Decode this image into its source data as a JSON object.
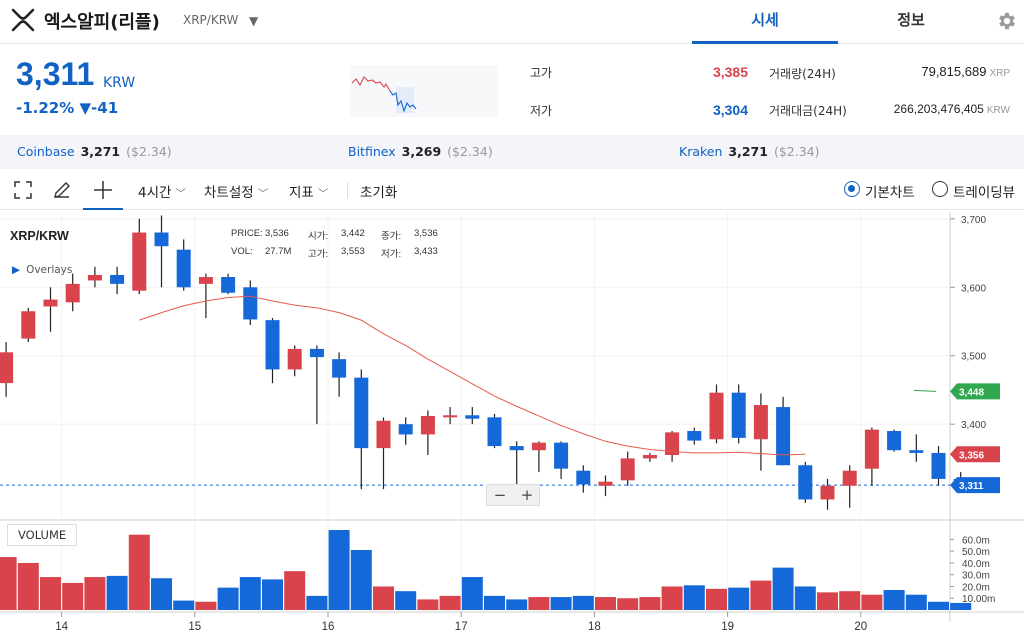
{
  "header": {
    "coin_name": "엑스알피(리플)",
    "pair": "XRP/KRW",
    "tabs": [
      {
        "label": "시세"
      },
      {
        "label": "정보"
      }
    ]
  },
  "ticker": {
    "price": "3,311",
    "unit": "KRW",
    "change_pct": "-1.22%",
    "change_arrow": "▼",
    "change_abs": "-41",
    "high_label": "고가",
    "high": "3,385",
    "low_label": "저가",
    "low": "3,304",
    "volume_label": "거래량(24H)",
    "volume": "79,815,689",
    "volume_unit": "XRP",
    "amount_label": "거래대금(24H)",
    "amount": "266,203,476,405",
    "amount_unit": "KRW"
  },
  "exchanges": [
    {
      "name": "Coinbase",
      "price": "3,271",
      "usd": "($2.34)"
    },
    {
      "name": "Bitfinex",
      "price": "3,269",
      "usd": "($2.34)"
    },
    {
      "name": "Kraken",
      "price": "3,271",
      "usd": "($2.34)"
    }
  ],
  "toolbar": {
    "interval": "4시간",
    "chart_settings": "차트설정",
    "indicators": "지표",
    "reset": "초기화",
    "basic_chart": "기본차트",
    "trading_view": "트레이딩뷰"
  },
  "legend": {
    "title": "XRP/KRW",
    "overlays": "Overlays",
    "price_label": "PRICE:",
    "price": "3,536",
    "open_label": "시가:",
    "open": "3,442",
    "close_label": "종가:",
    "close": "3,536",
    "vol_label": "VOL:",
    "vol": "27.7M",
    "high_label": "고가:",
    "high": "3,553",
    "low_label": "저가:",
    "low": "3,433"
  },
  "zoom": {
    "minus": "−",
    "plus": "+"
  },
  "volume_panel": {
    "label": "VOLUME"
  },
  "colors": {
    "up": "#d9434b",
    "down": "#1468d8",
    "accent": "#1261c4",
    "ma": "#e55a4e",
    "green": "#2fa84f"
  },
  "chart_data": {
    "type": "candlestick",
    "ylim": [
      3260,
      3710
    ],
    "y_ticks": [
      3700,
      3600,
      3500,
      3400
    ],
    "y_tick_labels": [
      "3,700",
      "3,600",
      "3,500",
      "3,400"
    ],
    "x_tick_labels": [
      "14",
      "15",
      "16",
      "17",
      "18",
      "19",
      "20"
    ],
    "x_tick_index": [
      2.5,
      8.5,
      14.5,
      20.5,
      26.5,
      32.5,
      38.5
    ],
    "price_markers": [
      {
        "label": "3,448",
        "value": 3448,
        "color": "#2fa84f"
      },
      {
        "label": "3,356",
        "value": 3356,
        "color": "#d9434b"
      },
      {
        "label": "3,311",
        "value": 3311,
        "color": "#1468d8"
      }
    ],
    "volume_ticks": [
      "60.0m",
      "50.0m",
      "40.0m",
      "30.0m",
      "20.0m",
      "10.00m"
    ],
    "volume_tick_values": [
      60,
      50,
      40,
      30,
      20,
      10
    ],
    "volume_max": 68,
    "candles": [
      {
        "o": 3460,
        "h": 3520,
        "l": 3440,
        "c": 3505
      },
      {
        "o": 3525,
        "h": 3570,
        "l": 3520,
        "c": 3565
      },
      {
        "o": 3572,
        "h": 3600,
        "l": 3535,
        "c": 3582
      },
      {
        "o": 3578,
        "h": 3620,
        "l": 3565,
        "c": 3605
      },
      {
        "o": 3610,
        "h": 3630,
        "l": 3600,
        "c": 3618
      },
      {
        "o": 3618,
        "h": 3630,
        "l": 3590,
        "c": 3605
      },
      {
        "o": 3595,
        "h": 3700,
        "l": 3590,
        "c": 3680
      },
      {
        "o": 3680,
        "h": 3705,
        "l": 3600,
        "c": 3660
      },
      {
        "o": 3655,
        "h": 3670,
        "l": 3595,
        "c": 3600
      },
      {
        "o": 3605,
        "h": 3620,
        "l": 3555,
        "c": 3615
      },
      {
        "o": 3615,
        "h": 3620,
        "l": 3590,
        "c": 3592
      },
      {
        "o": 3600,
        "h": 3610,
        "l": 3545,
        "c": 3553
      },
      {
        "o": 3552,
        "h": 3555,
        "l": 3460,
        "c": 3480
      },
      {
        "o": 3480,
        "h": 3515,
        "l": 3470,
        "c": 3510
      },
      {
        "o": 3510,
        "h": 3515,
        "l": 3400,
        "c": 3498
      },
      {
        "o": 3495,
        "h": 3505,
        "l": 3440,
        "c": 3468
      },
      {
        "o": 3468,
        "h": 3480,
        "l": 3305,
        "c": 3365
      },
      {
        "o": 3365,
        "h": 3410,
        "l": 3305,
        "c": 3405
      },
      {
        "o": 3400,
        "h": 3410,
        "l": 3370,
        "c": 3385
      },
      {
        "o": 3385,
        "h": 3420,
        "l": 3355,
        "c": 3412
      },
      {
        "o": 3410,
        "h": 3425,
        "l": 3400,
        "c": 3413
      },
      {
        "o": 3413,
        "h": 3425,
        "l": 3400,
        "c": 3408
      },
      {
        "o": 3410,
        "h": 3415,
        "l": 3365,
        "c": 3368
      },
      {
        "o": 3368,
        "h": 3375,
        "l": 3295,
        "c": 3362
      },
      {
        "o": 3362,
        "h": 3375,
        "l": 3330,
        "c": 3373
      },
      {
        "o": 3373,
        "h": 3375,
        "l": 3320,
        "c": 3335
      },
      {
        "o": 3332,
        "h": 3340,
        "l": 3300,
        "c": 3312
      },
      {
        "o": 3310,
        "h": 3325,
        "l": 3295,
        "c": 3316
      },
      {
        "o": 3318,
        "h": 3360,
        "l": 3310,
        "c": 3350
      },
      {
        "o": 3350,
        "h": 3358,
        "l": 3345,
        "c": 3355
      },
      {
        "o": 3355,
        "h": 3390,
        "l": 3345,
        "c": 3388
      },
      {
        "o": 3390,
        "h": 3395,
        "l": 3370,
        "c": 3376
      },
      {
        "o": 3378,
        "h": 3458,
        "l": 3372,
        "c": 3446
      },
      {
        "o": 3446,
        "h": 3458,
        "l": 3372,
        "c": 3380
      },
      {
        "o": 3378,
        "h": 3445,
        "l": 3332,
        "c": 3428
      },
      {
        "o": 3425,
        "h": 3440,
        "l": 3340,
        "c": 3340
      },
      {
        "o": 3340,
        "h": 3345,
        "l": 3285,
        "c": 3290
      },
      {
        "o": 3290,
        "h": 3320,
        "l": 3275,
        "c": 3310
      },
      {
        "o": 3310,
        "h": 3340,
        "l": 3278,
        "c": 3332
      },
      {
        "o": 3335,
        "h": 3395,
        "l": 3310,
        "c": 3392
      },
      {
        "o": 3390,
        "h": 3392,
        "l": 3360,
        "c": 3362
      },
      {
        "o": 3362,
        "h": 3385,
        "l": 3345,
        "c": 3358
      },
      {
        "o": 3358,
        "h": 3368,
        "l": 3310,
        "c": 3320
      },
      {
        "o": 3320,
        "h": 3330,
        "l": 3305,
        "c": 3311
      }
    ],
    "ma": [
      3552,
      3563,
      3573,
      3580,
      3585,
      3587,
      3580,
      3574,
      3570,
      3563,
      3552,
      3532,
      3515,
      3495,
      3477,
      3459,
      3441,
      3426,
      3412,
      3398,
      3386,
      3375,
      3368,
      3363,
      3360,
      3358,
      3358,
      3359,
      3357,
      3355,
      3356
    ],
    "ma_start_index": 6,
    "volumes": [
      45,
      40,
      28,
      23,
      28,
      29,
      64,
      27,
      8,
      7,
      19,
      28,
      26,
      33,
      12,
      68,
      51,
      20,
      16,
      9,
      12,
      28,
      12,
      9,
      11,
      11,
      12,
      11,
      10,
      11,
      20,
      21,
      18,
      19,
      25,
      36,
      20,
      15,
      16,
      13,
      17,
      13,
      7,
      6
    ]
  }
}
